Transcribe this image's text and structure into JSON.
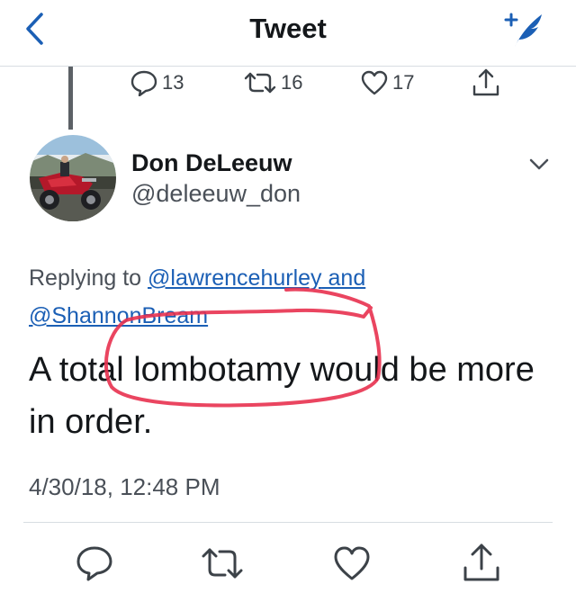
{
  "nav": {
    "title": "Tweet",
    "back_icon": "chevron-left-icon",
    "compose_icon": "compose-feather-icon",
    "accent_color": "#1b5fb5"
  },
  "parent_stats": {
    "replies": "13",
    "retweets": "16",
    "likes": "17"
  },
  "author": {
    "display_name": "Don DeLeeuw",
    "handle": "@deleeuw_don"
  },
  "reply_context": {
    "prefix": "Replying to ",
    "mention_1": "@lawrencehurley",
    "joiner": " and",
    "mention_2": "@ShannonBream"
  },
  "tweet": {
    "text": "A total lombotamy would be more in order.",
    "timestamp": "4/30/18, 12:48 PM"
  },
  "annotation": {
    "color": "#e8314f",
    "shape": "hand-drawn circle around a word"
  }
}
